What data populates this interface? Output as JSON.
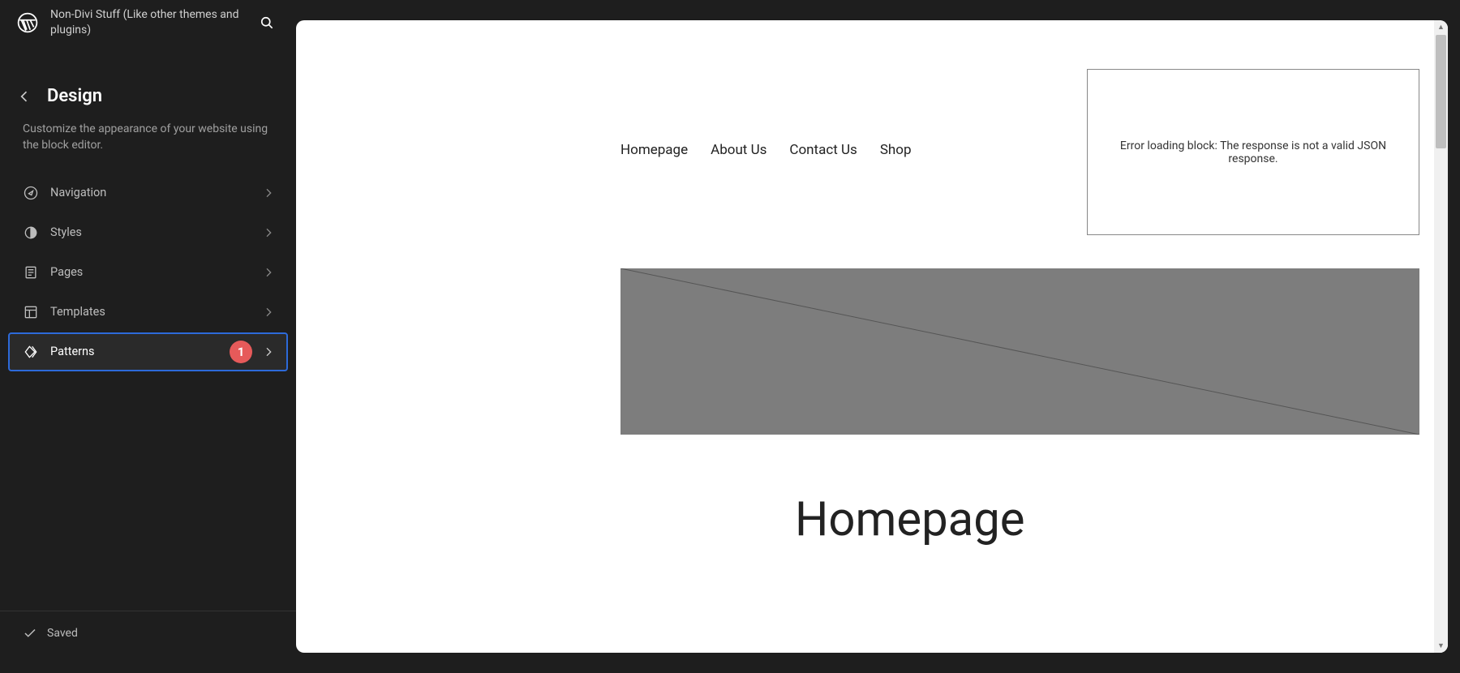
{
  "header": {
    "site_title": "Non-Divi Stuff (Like other themes and plugins)"
  },
  "section": {
    "title": "Design",
    "description": "Customize the appearance of your website using the block editor."
  },
  "menu": {
    "items": [
      {
        "label": "Navigation",
        "icon": "compass"
      },
      {
        "label": "Styles",
        "icon": "half-circle"
      },
      {
        "label": "Pages",
        "icon": "page"
      },
      {
        "label": "Templates",
        "icon": "layout"
      },
      {
        "label": "Patterns",
        "icon": "diamond"
      }
    ],
    "active_badge": "1"
  },
  "footer": {
    "status": "Saved"
  },
  "preview": {
    "nav": [
      "Homepage",
      "About Us",
      "Contact Us",
      "Shop"
    ],
    "error_message": "Error loading block: The response is not a valid JSON response.",
    "page_heading": "Homepage"
  }
}
